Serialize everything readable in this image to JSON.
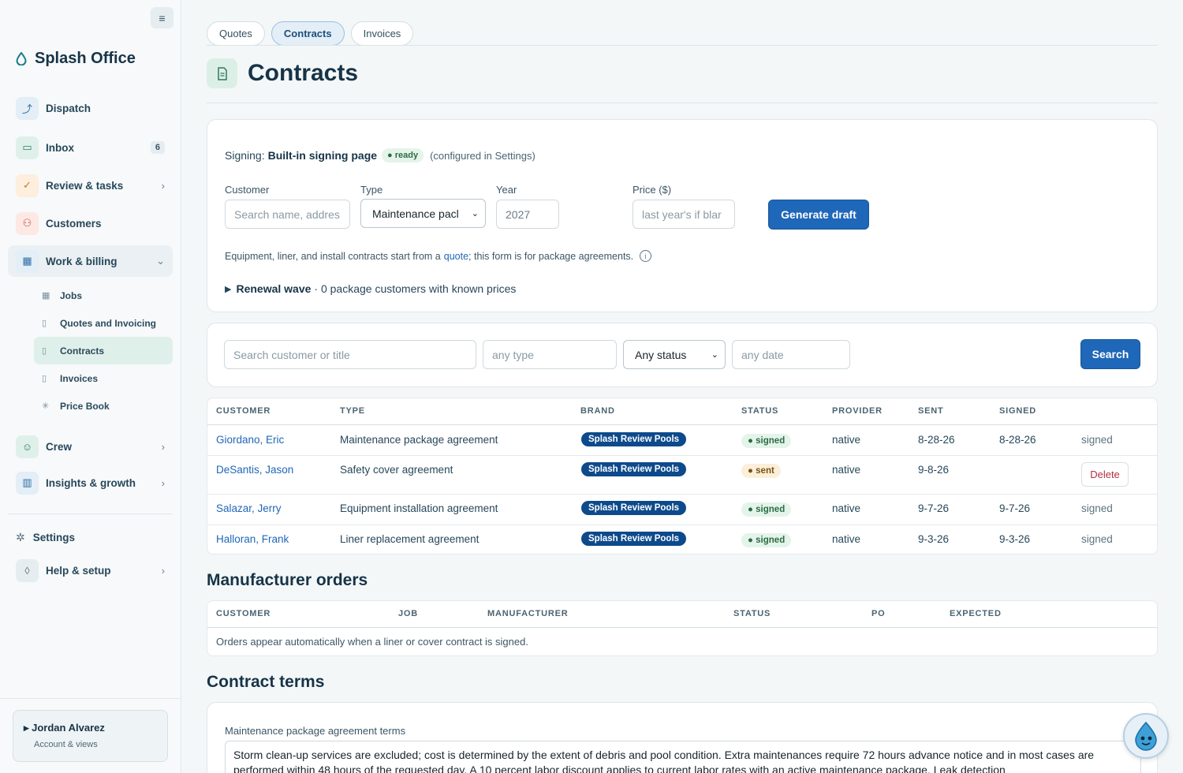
{
  "sidebar": {
    "brand": "Splash Office",
    "nav": [
      {
        "label": "Dispatch"
      },
      {
        "label": "Inbox",
        "badge": "6"
      },
      {
        "label": "Review & tasks"
      },
      {
        "label": "Customers"
      },
      {
        "label": "Work & billing"
      },
      {
        "label": "Crew"
      },
      {
        "label": "Insights & growth"
      },
      {
        "label": "Settings"
      },
      {
        "label": "Help & setup"
      }
    ],
    "sub": [
      {
        "label": "Jobs"
      },
      {
        "label": "Quotes and Invoicing"
      },
      {
        "label": "Contracts"
      },
      {
        "label": "Invoices"
      },
      {
        "label": "Price Book"
      }
    ],
    "user": {
      "name": "Jordan Alvarez",
      "sub": "Account & views"
    }
  },
  "tabs": [
    "Quotes",
    "Contracts",
    "Invoices"
  ],
  "page": {
    "title": "Contracts"
  },
  "draft": {
    "signing_prefix": "Signing:",
    "signing_name": "Built-in signing page",
    "ready": "ready",
    "configured": "(configured in Settings)",
    "customer_label": "Customer",
    "customer_placeholder": "Search name, addres",
    "type_label": "Type",
    "type_value": "Maintenance pacl",
    "year_label": "Year",
    "year_value": "2027",
    "price_label": "Price ($)",
    "price_placeholder": "last year's if blar",
    "generate": "Generate draft",
    "note_before": "Equipment, liner, and install contracts start from a",
    "note_link": "quote",
    "note_after": "; this form is for package agreements.",
    "renewal_title": "Renewal wave",
    "renewal_rest": "· 0 package customers with known prices"
  },
  "filters": {
    "search_placeholder": "Search customer or title",
    "type_placeholder": "any type",
    "status_value": "Any status",
    "date_placeholder": "any date",
    "search_button": "Search"
  },
  "contracts_table": {
    "headers": [
      "CUSTOMER",
      "TYPE",
      "BRAND",
      "STATUS",
      "PROVIDER",
      "SENT",
      "SIGNED"
    ],
    "rows": [
      {
        "customer": "Giordano, Eric",
        "type": "Maintenance package agreement",
        "brand": "Splash Review Pools",
        "status": "signed",
        "provider": "native",
        "sent": "8-28-26",
        "signed": "8-28-26",
        "action": "signed"
      },
      {
        "customer": "DeSantis, Jason",
        "type": "Safety cover agreement",
        "brand": "Splash Review Pools",
        "status": "sent",
        "provider": "native",
        "sent": "9-8-26",
        "signed": "",
        "action": "Delete"
      },
      {
        "customer": "Salazar, Jerry",
        "type": "Equipment installation agreement",
        "brand": "Splash Review Pools",
        "status": "signed",
        "provider": "native",
        "sent": "9-7-26",
        "signed": "9-7-26",
        "action": "signed"
      },
      {
        "customer": "Halloran, Frank",
        "type": "Liner replacement agreement",
        "brand": "Splash Review Pools",
        "status": "signed",
        "provider": "native",
        "sent": "9-3-26",
        "signed": "9-3-26",
        "action": "signed"
      }
    ]
  },
  "manufacturer": {
    "title": "Manufacturer orders",
    "headers": [
      "CUSTOMER",
      "JOB",
      "MANUFACTURER",
      "STATUS",
      "PO",
      "EXPECTED"
    ],
    "empty": "Orders appear automatically when a liner or cover contract is signed."
  },
  "terms": {
    "title": "Contract terms",
    "label": "Maintenance package agreement terms",
    "text": "Storm clean-up services are excluded; cost is determined by the extent of debris and pool condition. Extra maintenances require 72 hours advance notice and in most cases are performed within 48 hours of the requested day. A 10 percent labor discount applies to current labor rates with an active maintenance package. Leak detection"
  },
  "colors": {
    "primary": "#1f67b8",
    "brand_pill": "#0d4a8c",
    "signed": "#2c6b44",
    "sent": "#7a5310",
    "active_sub": "#dff0ea"
  }
}
